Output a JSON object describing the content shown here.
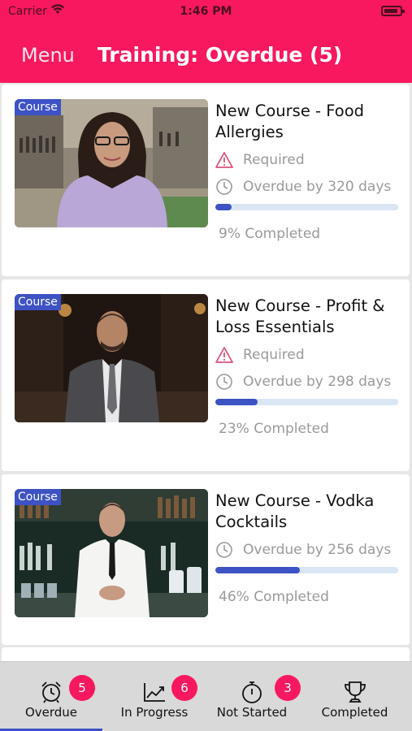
{
  "status_bar": {
    "carrier": "Carrier",
    "time": "1:46 PM"
  },
  "nav": {
    "menu_label": "Menu",
    "title": "Training: Overdue (5)"
  },
  "courses": [
    {
      "tag": "Course",
      "title": "New Course - Food Allergies",
      "required_label": "Required",
      "overdue_label": "Overdue by 320 days",
      "progress": 0.09,
      "completed_label": "9% Completed"
    },
    {
      "tag": "Course",
      "title": "New Course - Profit & Loss Essentials",
      "required_label": "Required",
      "overdue_label": "Overdue by 298 days",
      "progress": 0.23,
      "completed_label": "23% Completed"
    },
    {
      "tag": "Course",
      "title": "New Course - Vodka Cocktails",
      "overdue_label": "Overdue by 256 days",
      "progress": 0.46,
      "completed_label": "46% Completed"
    }
  ],
  "tabs": [
    {
      "label": "Overdue",
      "badge": "5",
      "icon": "alarm-clock-icon",
      "active": true
    },
    {
      "label": "In Progress",
      "badge": "6",
      "icon": "trending-chart-icon",
      "active": false
    },
    {
      "label": "Not Started",
      "badge": "3",
      "icon": "stopwatch-icon",
      "active": false
    },
    {
      "label": "Completed",
      "icon": "trophy-icon",
      "active": false
    }
  ],
  "colors": {
    "brand": "#f7185f",
    "accent": "#3d52c4",
    "track": "#dbe6f5",
    "warning": "#e0527a"
  }
}
